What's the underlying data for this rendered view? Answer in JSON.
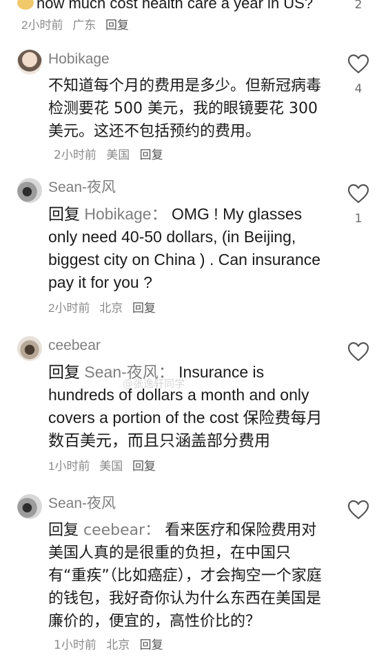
{
  "top": {
    "text": "how much cost health care a year in US?",
    "time": "2小时前",
    "location": "广东",
    "reply": "回复",
    "like_count": "2"
  },
  "comments": [
    {
      "username": "Hobikage",
      "text": "不知道每个月的费用是多少。但新冠病毒检测要花 500 美元，我的眼镜要花 300 美元。这还不包括预约的费用。",
      "time": "2小时前",
      "location": "美国",
      "reply": "回复",
      "like_count": "4"
    },
    {
      "username": "Sean-夜风",
      "reply_prefix": "回复",
      "mention": "Hobikage：",
      "text": "OMG ! My glasses only need 40-50 dollars, (in Beijing, biggest city on China ) . Can insurance pay it for you ?",
      "time": "2小时前",
      "location": "北京",
      "reply": "回复",
      "like_count": "1"
    },
    {
      "username": "ceebear",
      "reply_prefix": "回复",
      "mention": "Sean-夜风：",
      "text": "Insurance is hundreds of dollars a month and only covers a portion of the cost 保险费每月数百美元，而且只涵盖部分费用",
      "time": "1小时前",
      "location": "美国",
      "reply": "回复",
      "like_count": ""
    },
    {
      "username": "Sean-夜风",
      "reply_prefix": "回复",
      "mention": "ceebear：",
      "text": "看来医疗和保险费用对美国人真的是很重的负担，在中国只有“重疾”（比如癌症），才会掏空一个家庭的钱包，我好奇你认为什么东西在美国是廉价的，便宜的，高性价比的？",
      "time": "1小时前",
      "location": "北京",
      "reply": "回复",
      "like_count": ""
    }
  ],
  "watermark": "@张逸轩同学",
  "colors": {
    "text": "#1a1a1a",
    "muted": "#7e7e7e",
    "meta": "#8a8a8a"
  },
  "icons": {
    "like": "heart-outline-icon",
    "top_emoji": "emoji-face-icon"
  }
}
